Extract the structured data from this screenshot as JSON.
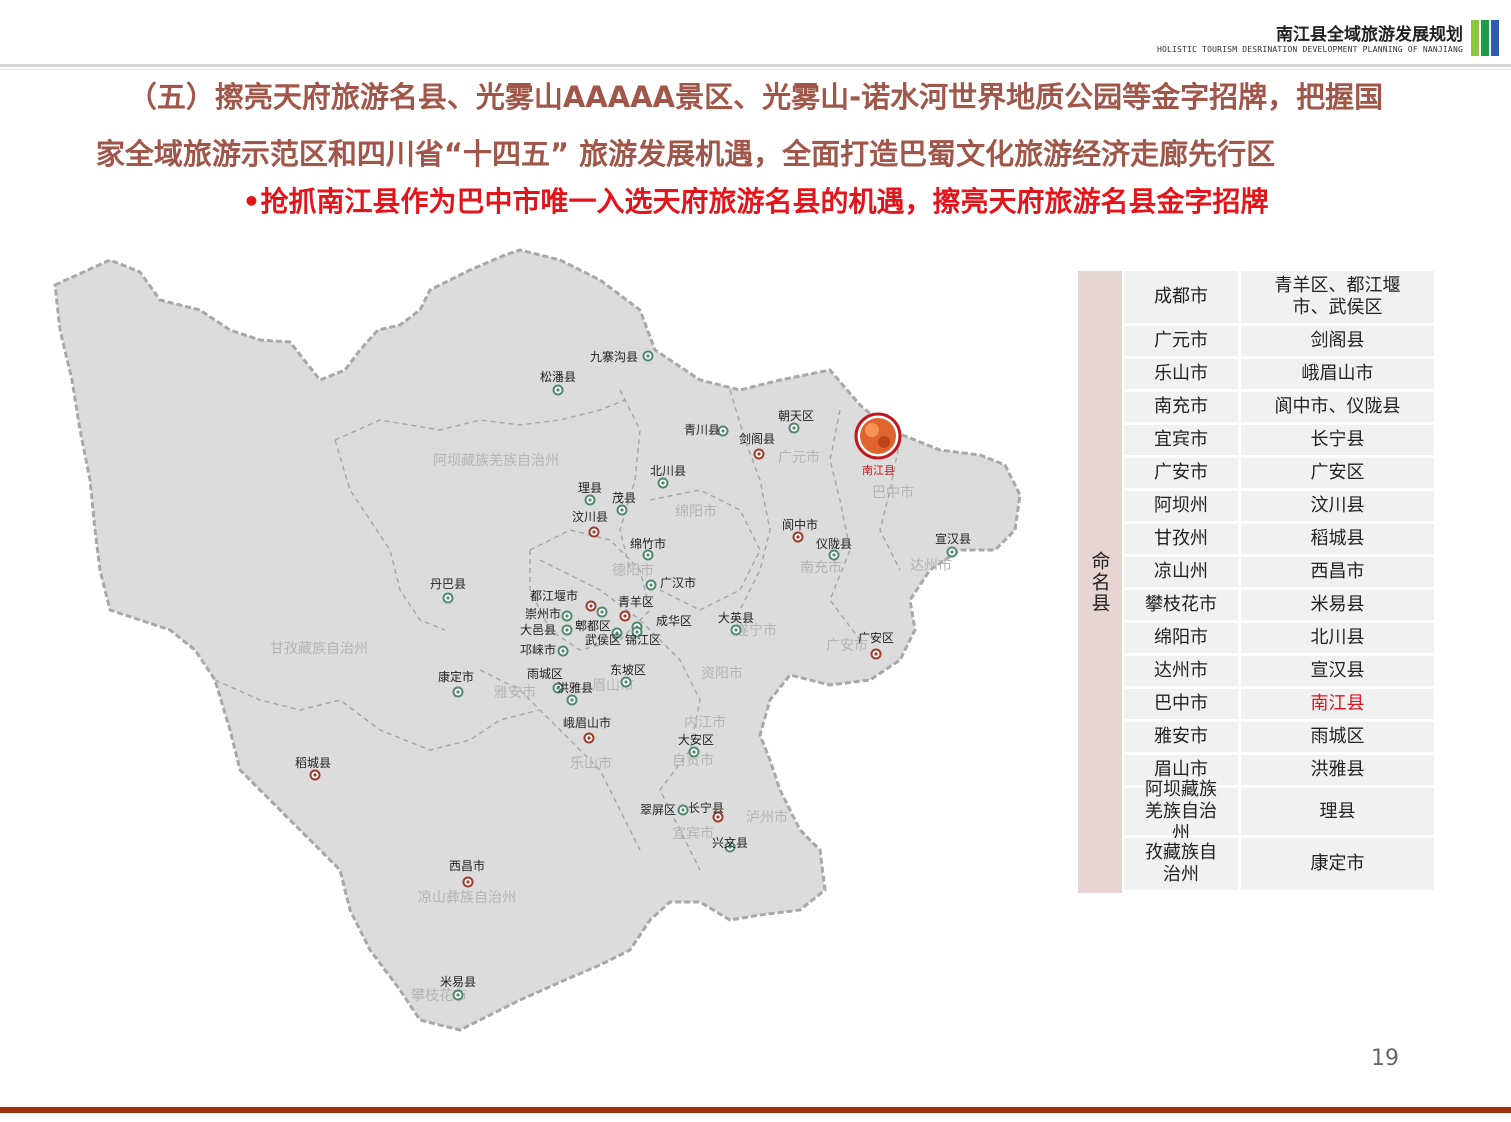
{
  "header": {
    "title": "南江县全域旅游发展规划",
    "subtitle": "HOLISTIC TOURISM DESRINATION DEVELOPMENT PLANNING OF NANJIANG",
    "bar_colors": [
      "#8cc63e",
      "#1a9d49",
      "#2b5bb5"
    ]
  },
  "heading": {
    "line1": "（五）擦亮天府旅游名县、光雾山AAAAA景区、光雾山-诺水河世界地质公园等金字招牌，把握国",
    "line2": "家全域旅游示范区和四川省“十四五” 旅游发展机遇，全面打造巴蜀文化旅游经济走廊先行区",
    "bullet": "•",
    "bullet_text": "抢抓南江县作为巴中市唯一入选天府旅游名县的机遇，擦亮天府旅游名县金字招牌",
    "colors": {
      "heading": "#a0574a",
      "bullet": "#e5141b"
    }
  },
  "map": {
    "fill": "#dcdcdc",
    "border": "#a8a8a8",
    "regions": [
      {
        "name": "阿坝藏族羌族自治州"
      },
      {
        "name": "甘孜藏族自治州"
      },
      {
        "name": "凉山彝族自治州"
      },
      {
        "name": "广元市"
      },
      {
        "name": "巴中市"
      },
      {
        "name": "绵阳市"
      },
      {
        "name": "德阳市"
      },
      {
        "name": "南充市"
      },
      {
        "name": "达州市"
      },
      {
        "name": "遂宁市"
      },
      {
        "name": "广安市"
      },
      {
        "name": "资阳市"
      },
      {
        "name": "眉山市"
      },
      {
        "name": "雅安市"
      },
      {
        "name": "内江市"
      },
      {
        "name": "乐山市"
      },
      {
        "name": "自贡市"
      },
      {
        "name": "宜宾市"
      },
      {
        "name": "泸州市"
      },
      {
        "name": "攀枝花市"
      }
    ],
    "places": [
      {
        "name": "九寨沟县",
        "kind": "green"
      },
      {
        "name": "松潘县",
        "kind": "green"
      },
      {
        "name": "青川县",
        "kind": "green"
      },
      {
        "name": "剑阁县",
        "kind": "red"
      },
      {
        "name": "朝天区",
        "kind": "green"
      },
      {
        "name": "北川县",
        "kind": "green"
      },
      {
        "name": "理县",
        "kind": "green"
      },
      {
        "name": "茂县",
        "kind": "green"
      },
      {
        "name": "汶川县",
        "kind": "red"
      },
      {
        "name": "阆中市",
        "kind": "red"
      },
      {
        "name": "仪陇县",
        "kind": "green"
      },
      {
        "name": "宣汉县",
        "kind": "green"
      },
      {
        "name": "绵竹市",
        "kind": "green"
      },
      {
        "name": "广汉市",
        "kind": "green"
      },
      {
        "name": "丹巴县",
        "kind": "green"
      },
      {
        "name": "都江堰市",
        "kind": "red"
      },
      {
        "name": "青羊区",
        "kind": "red"
      },
      {
        "name": "崇州市",
        "kind": "green"
      },
      {
        "name": "郫都区",
        "kind": "green"
      },
      {
        "name": "成华区",
        "kind": "green"
      },
      {
        "name": "大邑县",
        "kind": "green"
      },
      {
        "name": "武侯区",
        "kind": "green"
      },
      {
        "name": "锦江区",
        "kind": "green"
      },
      {
        "name": "大英县",
        "kind": "green"
      },
      {
        "name": "广安区",
        "kind": "red"
      },
      {
        "name": "邛崃市",
        "kind": "green"
      },
      {
        "name": "康定市",
        "kind": "green"
      },
      {
        "name": "雨城区",
        "kind": "green"
      },
      {
        "name": "东坡区",
        "kind": "green"
      },
      {
        "name": "洪雅县",
        "kind": "green"
      },
      {
        "name": "峨眉山市",
        "kind": "red"
      },
      {
        "name": "大安区",
        "kind": "green"
      },
      {
        "name": "稻城县",
        "kind": "red"
      },
      {
        "name": "翠屏区",
        "kind": "green"
      },
      {
        "name": "长宁县",
        "kind": "red"
      },
      {
        "name": "兴文县",
        "kind": "green"
      },
      {
        "name": "西昌市",
        "kind": "red"
      },
      {
        "name": "米易县",
        "kind": "green"
      }
    ],
    "highlight": {
      "name": "南江县"
    }
  },
  "table": {
    "side_label": "命名县",
    "rows": [
      {
        "city": "成都市",
        "county": "青羊区、都江堰市、武侯区"
      },
      {
        "city": "广元市",
        "county": "剑阁县"
      },
      {
        "city": "乐山市",
        "county": "峨眉山市"
      },
      {
        "city": "南充市",
        "county": "阆中市、仪陇县"
      },
      {
        "city": "宜宾市",
        "county": "长宁县"
      },
      {
        "city": "广安市",
        "county": "广安区"
      },
      {
        "city": "阿坝州",
        "county": "汶川县"
      },
      {
        "city": "甘孜州",
        "county": "稻城县"
      },
      {
        "city": "凉山州",
        "county": "西昌市"
      },
      {
        "city": "攀枝花市",
        "county": "米易县"
      },
      {
        "city": "绵阳市",
        "county": "北川县"
      },
      {
        "city": "达州市",
        "county": "宣汉县"
      },
      {
        "city": "巴中市",
        "county": "南江县",
        "highlight": true
      },
      {
        "city": "雅安市",
        "county": "雨城区"
      },
      {
        "city": "眉山市",
        "county": "洪雅县"
      },
      {
        "city": "阿坝藏族羌族自治州",
        "county": "理县"
      },
      {
        "city": "孜藏族自治州",
        "county": "康定市"
      }
    ],
    "highlight_color": "#e5141b"
  },
  "page_number": "19",
  "footer_color": "#a2300d"
}
